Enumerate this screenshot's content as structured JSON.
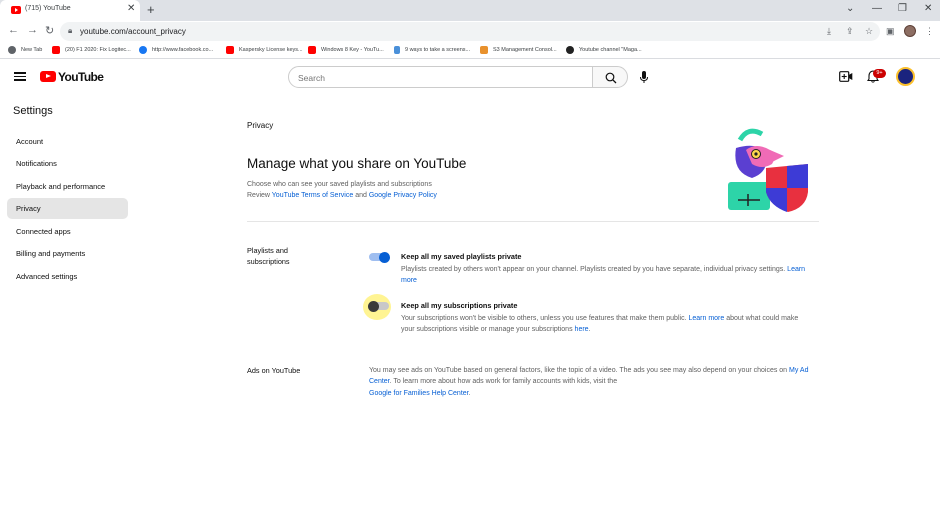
{
  "browser": {
    "tab_title": "(715) YouTube",
    "url": "youtube.com/account_privacy",
    "bookmarks": [
      "New Tab",
      "(20) F1 2020: Fix Logitec...",
      "http://www.facebook.co...",
      "Kaspersky License keys...",
      "Windows 8 Key - YouTu...",
      "9 ways to take a screens...",
      "S3 Management Consol...",
      "Youtube channel \"Maga..."
    ]
  },
  "header": {
    "logo_text": "YouTube",
    "search_placeholder": "Search",
    "notification_count": "9+"
  },
  "sidebar": {
    "title": "Settings",
    "items": [
      "Account",
      "Notifications",
      "Playback and performance",
      "Privacy",
      "Connected apps",
      "Billing and payments",
      "Advanced settings"
    ],
    "active_item": "Privacy"
  },
  "main": {
    "section_label": "Privacy",
    "heading": "Manage what you share on YouTube",
    "intro_line1": "Choose who can see your saved playlists and subscriptions",
    "intro_review": "Review",
    "intro_tos_link": "YouTube Terms of Service",
    "intro_and": "and",
    "intro_privacy_link": "Google Privacy Policy",
    "playlists_section": {
      "label": "Playlists and subscriptions",
      "playlists_toggle_label": "Keep all my saved playlists private",
      "playlists_toggle_on": true,
      "playlists_desc": "Playlists created by others won't appear on your channel. Playlists created by you have separate, individual privacy settings.",
      "playlists_learn_more": "Learn more",
      "subscriptions_toggle_label": "Keep all my subscriptions private",
      "subscriptions_toggle_on": false,
      "subscriptions_desc_1": "Your subscriptions won't be visible to others, unless you use features that make them public.",
      "subscriptions_learn_more": "Learn more",
      "subscriptions_desc_2": "about what could make your subscriptions visible or manage your subscriptions",
      "subscriptions_here": "here",
      "subscriptions_period": "."
    },
    "ads_section": {
      "label": "Ads on YouTube",
      "desc_1": "You may see ads on YouTube based on general factors, like the topic of a video. The ads you see may also depend on your choices on",
      "my_ad_center": "My Ad Center",
      "desc_2": ". To learn more about how ads work for family accounts with kids, visit the",
      "families_link": "Google for Families Help Center",
      "period": "."
    }
  },
  "colors": {
    "toggle_on": "#065fd4",
    "toggle_off": "#909090",
    "link": "#065fd4",
    "brand_red": "#ff0000"
  }
}
